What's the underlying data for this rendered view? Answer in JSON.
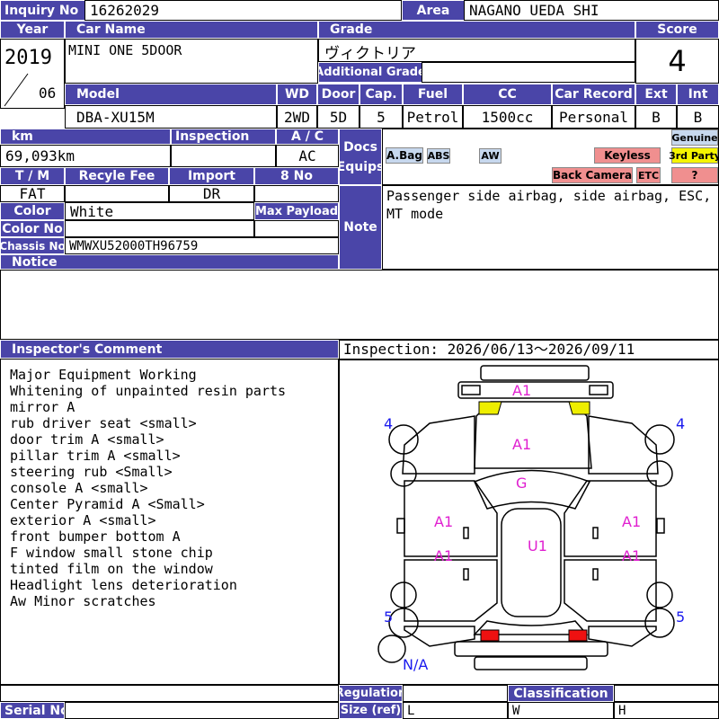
{
  "inquiry": {
    "label": "Inquiry No",
    "value": "16262029"
  },
  "area": {
    "label": "Area",
    "value": "NAGANO UEDA SHI"
  },
  "year": {
    "label": "Year",
    "value": "2019",
    "month": "06"
  },
  "car_name": {
    "label": "Car Name",
    "value": "MINI ONE 5DOOR"
  },
  "grade": {
    "label": "Grade",
    "value": "ヴィクトリア",
    "additional_label": "Additional Grade"
  },
  "score": {
    "label": "Score",
    "value": "4"
  },
  "model": {
    "label": "Model",
    "value": "DBA-XU15M"
  },
  "wd": {
    "label": "WD",
    "value": "2WD"
  },
  "door": {
    "label": "Door",
    "value": "5D"
  },
  "cap": {
    "label": "Cap.",
    "value": "5"
  },
  "fuel": {
    "label": "Fuel",
    "value": "Petrol"
  },
  "cc": {
    "label": "CC",
    "value": "1500cc"
  },
  "car_record": {
    "label": "Car Record",
    "value": "Personal"
  },
  "ext": {
    "label": "Ext",
    "value": "B"
  },
  "int": {
    "label": "Int",
    "value": "B"
  },
  "km": {
    "label": "km",
    "value": "69,093km"
  },
  "inspection_field": {
    "label": "Inspection",
    "value": ""
  },
  "ac": {
    "label": "A / C",
    "value": "AC"
  },
  "docs_equips": {
    "label_line1": "Docs",
    "label_line2": "Equips"
  },
  "equipment_tags": {
    "abag": "A.Bag",
    "abs": "ABS",
    "aw": "AW",
    "keyless": "Keyless",
    "back_camera": "Back Camera",
    "etc": "ETC",
    "genuine": "Genuine",
    "third_party": "3rd Party",
    "unknown": "?"
  },
  "tm": {
    "label": "T / M",
    "value": "FAT"
  },
  "recycle_fee": {
    "label": "Recyle Fee",
    "value": ""
  },
  "import": {
    "label": "Import",
    "value": "DR"
  },
  "eight_no": {
    "label": "8 No",
    "value": ""
  },
  "color": {
    "label": "Color",
    "value": "White"
  },
  "max_payload": {
    "label": "Max Payload",
    "value": ""
  },
  "color_no": {
    "label": "Color No",
    "value": ""
  },
  "chassis_no": {
    "label": "Chassis No",
    "value": "WMWXU52000TH96759"
  },
  "notice": {
    "label": "Notice",
    "value": ""
  },
  "note": {
    "label": "Note",
    "value": "Passenger side airbag, side airbag, ESC, MT mode"
  },
  "inspector_comment": {
    "label": "Inspector's Comment",
    "lines": [
      "Major Equipment Working",
      "Whitening of unpainted resin parts",
      "mirror A",
      "rub driver seat <small>",
      "door trim A <small>",
      "pillar trim A <small>",
      "steering rub <Small>",
      "console A <small>",
      "Center Pyramid A <Small>",
      "exterior A <small>",
      "front bumper bottom A",
      "F window small stone chip",
      "tinted film on the window",
      "Headlight lens deterioration",
      "Aw Minor scratches"
    ]
  },
  "inspection_period": "Inspection: 2026/06/13〜2026/09/11",
  "diagram": {
    "marks": {
      "front_bumper": "A1",
      "hood": "A1",
      "windshield": "G",
      "front_left_door": "A1",
      "rear_left_door": "A1",
      "front_right_door": "A1",
      "rear_right_door": "A1",
      "roof": "U1"
    },
    "tyres": {
      "front_left": "4",
      "front_right": "4",
      "rear_left": "5",
      "rear_right": "5"
    },
    "spare": "N/A",
    "colors": {
      "mark": "#e020d0",
      "tyre": "#1a1aee",
      "headlight": "#eeee00",
      "taillight": "#ee1111"
    }
  },
  "regulation": {
    "label": "Regulation"
  },
  "size_ref": {
    "label": "Size (ref)",
    "l": "L",
    "w": "W",
    "h": "H"
  },
  "classification": {
    "label": "Classification"
  },
  "serial_no": {
    "label": "Serial No",
    "value": ""
  },
  "theme": {
    "header": "#4a45a8",
    "tag_blue": "#c7d8ee",
    "tag_red": "#f08f8f",
    "tag_yellow": "#f5f500"
  }
}
